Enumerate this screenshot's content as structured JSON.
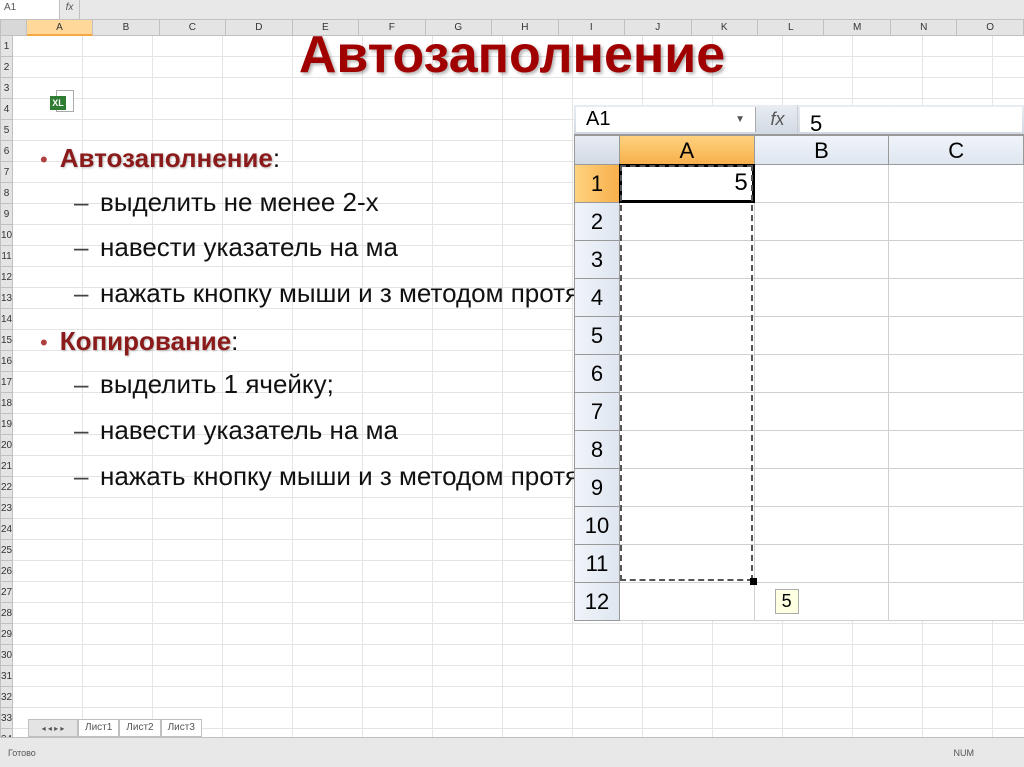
{
  "bg": {
    "name_box": "A1",
    "fx_label": "fx",
    "columns": [
      "A",
      "B",
      "C",
      "D",
      "E",
      "F",
      "G",
      "H",
      "I",
      "J",
      "K",
      "L",
      "M",
      "N",
      "O"
    ],
    "row_count": 34,
    "active_col_index": 0,
    "active_row_index": 0,
    "tabs": {
      "sheets": [
        "Лист1",
        "Лист2",
        "Лист3"
      ],
      "nav": "◂ ◂ ▸ ▸"
    },
    "status": "Готово",
    "indicator": "NUM"
  },
  "title": "Автозаполнение",
  "excel_icon_label": "XL",
  "sections": [
    {
      "head": "Автозаполнение",
      "colon": ":",
      "items": [
        "выделить не менее 2-х",
        "навести указатель на ма",
        "нажать кнопку мыши и з методом протяжки."
      ]
    },
    {
      "head": "Копирование",
      "colon": ":",
      "items": [
        "выделить 1 ячейку;",
        "навести указатель на ма",
        "нажать кнопку мыши и з методом протяжки."
      ]
    }
  ],
  "inset": {
    "name_box": "A1",
    "fx_label": "fx",
    "formula_value": "5",
    "columns": [
      "A",
      "B",
      "C"
    ],
    "active_col_index": 0,
    "rows": [
      {
        "n": "1",
        "cells": [
          "5",
          "",
          ""
        ],
        "active": true
      },
      {
        "n": "2",
        "cells": [
          "",
          "",
          ""
        ]
      },
      {
        "n": "3",
        "cells": [
          "",
          "",
          ""
        ]
      },
      {
        "n": "4",
        "cells": [
          "",
          "",
          ""
        ]
      },
      {
        "n": "5",
        "cells": [
          "",
          "",
          ""
        ]
      },
      {
        "n": "6",
        "cells": [
          "",
          "",
          ""
        ]
      },
      {
        "n": "7",
        "cells": [
          "",
          "",
          ""
        ]
      },
      {
        "n": "8",
        "cells": [
          "",
          "",
          ""
        ]
      },
      {
        "n": "9",
        "cells": [
          "",
          "",
          ""
        ]
      },
      {
        "n": "10",
        "cells": [
          "",
          "",
          ""
        ]
      },
      {
        "n": "11",
        "cells": [
          "",
          "",
          ""
        ]
      },
      {
        "n": "12",
        "cells": [
          "",
          "",
          ""
        ]
      }
    ],
    "marquee": {
      "from_row": 1,
      "to_row": 11,
      "col": 0
    },
    "fill_tooltip": "5"
  }
}
